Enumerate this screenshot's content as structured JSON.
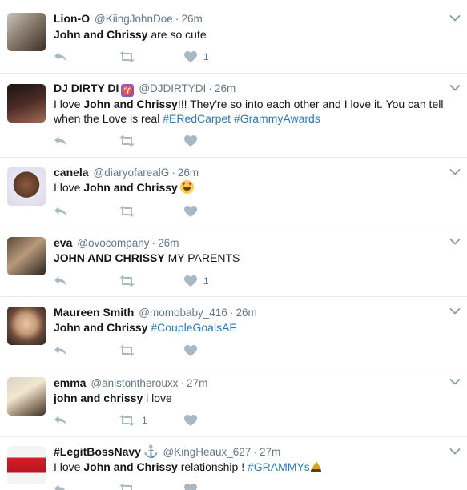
{
  "tweets": [
    {
      "name": "Lion-O",
      "handle": "@KiingJohnDoe",
      "time": "26m",
      "text": [
        {
          "t": "John and Chrissy",
          "b": true
        },
        {
          "t": " are so cute"
        }
      ],
      "retweets": "",
      "likes": "1",
      "avatar_icon": "avatar-photo"
    },
    {
      "name": "DJ DIRTY DI",
      "badge": "♈",
      "handle": "@DJDIRTYDI",
      "time": "26m",
      "text": [
        {
          "t": "I love "
        },
        {
          "t": "John and Chrissy",
          "b": true
        },
        {
          "t": "!!! They're so into each other and I love it.  You can tell when the Love is real "
        },
        {
          "t": "#ERedCarpet",
          "tag": true
        },
        {
          "t": " "
        },
        {
          "t": "#GrammyAwards",
          "tag": true
        }
      ],
      "retweets": "",
      "likes": "",
      "avatar_icon": "avatar-photo"
    },
    {
      "name": "canela",
      "handle": "@diaryofarealG",
      "time": "26m",
      "text": [
        {
          "t": "I love "
        },
        {
          "t": "John and Chrissy",
          "b": true
        },
        {
          "emoji": "heart-eyes"
        }
      ],
      "retweets": "",
      "likes": "",
      "avatar_icon": "avatar-photo"
    },
    {
      "name": "eva",
      "handle": "@ovocompany",
      "time": "26m",
      "text": [
        {
          "t": "JOHN AND CHRISSY",
          "b": true
        },
        {
          "t": " MY PARENTS"
        }
      ],
      "retweets": "",
      "likes": "1",
      "avatar_icon": "avatar-photo"
    },
    {
      "name": "Maureen Smith",
      "handle": "@momobaby_416",
      "time": "26m",
      "text": [
        {
          "t": "John and Chrissy",
          "b": true
        },
        {
          "t": " "
        },
        {
          "t": "#CoupleGoalsAF",
          "tag": true
        }
      ],
      "retweets": "",
      "likes": "",
      "avatar_icon": "avatar-photo"
    },
    {
      "name": "emma",
      "handle": "@anistontherouxx",
      "time": "27m",
      "text": [
        {
          "t": "john and chrissy",
          "b": true
        },
        {
          "t": " i love"
        }
      ],
      "retweets": "1",
      "likes": "",
      "avatar_icon": "avatar-photo"
    },
    {
      "name": "#LegitBossNavy",
      "badge_anchor": "⚓",
      "handle": "@KingHeaux_627",
      "time": "27m",
      "text": [
        {
          "t": "I love "
        },
        {
          "t": "John and Chrissy",
          "b": true
        },
        {
          "t": " relationship ! "
        },
        {
          "t": "#GRAMMYs",
          "tag": true
        },
        {
          "emoji": "gramophone"
        }
      ],
      "retweets": "",
      "likes": "",
      "avatar_icon": "avatar-photo"
    }
  ],
  "colors": {
    "link": "#2b7bb9",
    "muted": "#657786",
    "icon": "#aab8c2",
    "text": "#14171a"
  },
  "icons": {
    "reply": "reply-icon",
    "retweet": "retweet-icon",
    "like": "heart-icon",
    "menu": "chevron-down-icon"
  }
}
